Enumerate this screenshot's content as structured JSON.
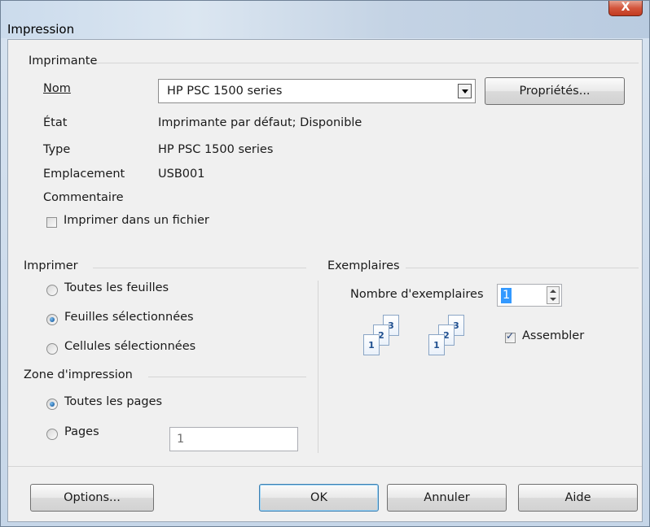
{
  "window": {
    "title": "Impression",
    "close_label": "X"
  },
  "printer": {
    "group_label": "Imprimante",
    "name_label": "Nom",
    "name_value": "HP PSC 1500 series",
    "properties_label": "Propriétés...",
    "status_label": "État",
    "status_value": "Imprimante par défaut; Disponible",
    "type_label": "Type",
    "type_value": "HP PSC 1500 series",
    "location_label": "Emplacement",
    "location_value": "USB001",
    "comment_label": "Commentaire",
    "print_to_file_label": "Imprimer dans un fichier",
    "print_to_file_checked": false
  },
  "print": {
    "group_label": "Imprimer",
    "options": [
      {
        "label": "Toutes les feuilles",
        "checked": false
      },
      {
        "label": "Feuilles sélectionnées",
        "checked": true
      },
      {
        "label": "Cellules sélectionnées",
        "checked": false
      }
    ]
  },
  "zone": {
    "group_label": "Zone d'impression",
    "all_pages_label": "Toutes les pages",
    "all_pages_checked": true,
    "pages_label": "Pages",
    "pages_checked": false,
    "pages_value": "1"
  },
  "copies": {
    "group_label": "Exemplaires",
    "count_label": "Nombre d'exemplaires",
    "count_value": "1",
    "collate_label": "Assembler",
    "collate_checked": true,
    "collate_icon_digits": [
      "1",
      "2",
      "3"
    ]
  },
  "buttons": {
    "options": "Options...",
    "ok": "OK",
    "cancel": "Annuler",
    "help": "Aide"
  }
}
